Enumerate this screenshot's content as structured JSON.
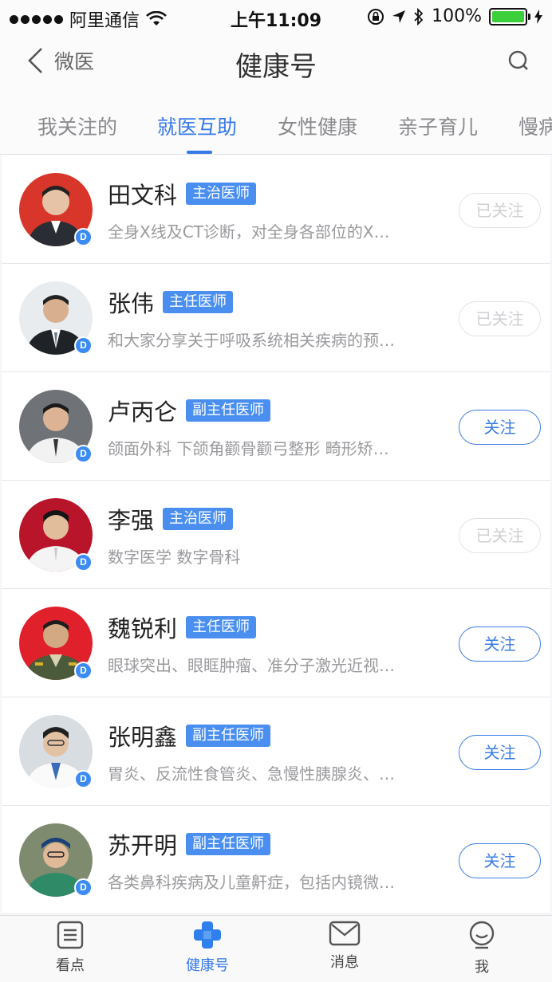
{
  "status_bar": {
    "carrier": "阿里通信",
    "time": "上午11:09",
    "battery": "100%"
  },
  "nav": {
    "back_label": "微医",
    "title": "健康号",
    "search_icon": "search-icon"
  },
  "tabs": [
    {
      "label": "我关注的"
    },
    {
      "label": "就医互助",
      "active": true
    },
    {
      "label": "女性健康"
    },
    {
      "label": "亲子育儿"
    },
    {
      "label": "慢病"
    }
  ],
  "doctors": [
    {
      "name": "田文科",
      "rank": "主治医师",
      "desc": "全身X线及CT诊断，对全身各部位的X…",
      "verified": "D",
      "follow_label": "已关注",
      "following": true,
      "avatar_bg": "#d8362a"
    },
    {
      "name": "张伟",
      "rank": "主任医师",
      "desc": "和大家分享关于呼吸系统相关疾病的预…",
      "verified": "D",
      "follow_label": "已关注",
      "following": true,
      "avatar_bg": "#e9ecef"
    },
    {
      "name": "卢丙仑",
      "rank": "副主任医师",
      "desc": "颌面外科 下颌角颧骨颧弓整形 畸形矫…",
      "verified": "D",
      "follow_label": "关注",
      "following": false,
      "avatar_bg": "#6f7277"
    },
    {
      "name": "李强",
      "rank": "主治医师",
      "desc": "数字医学 数字骨科",
      "verified": "D",
      "follow_label": "已关注",
      "following": true,
      "avatar_bg": "#b8142a"
    },
    {
      "name": "魏锐利",
      "rank": "主任医师",
      "desc": "眼球突出、眼眶肿瘤、准分子激光近视…",
      "verified": "D",
      "follow_label": "关注",
      "following": false,
      "avatar_bg": "#e0202a"
    },
    {
      "name": "张明鑫",
      "rank": "副主任医师",
      "desc": "胃炎、反流性食管炎、急慢性胰腺炎、…",
      "verified": "D",
      "follow_label": "关注",
      "following": false,
      "avatar_bg": "#d8dde2"
    },
    {
      "name": "苏开明",
      "rank": "副主任医师",
      "desc": "各类鼻科疾病及儿童鼾症，包括内镜微…",
      "verified": "D",
      "follow_label": "关注",
      "following": false,
      "avatar_bg": "#7f8b6e"
    }
  ],
  "bottom_tabs": [
    {
      "label": "看点",
      "icon": "news-icon"
    },
    {
      "label": "健康号",
      "icon": "health-cross-icon",
      "active": true
    },
    {
      "label": "消息",
      "icon": "mail-icon"
    },
    {
      "label": "我",
      "icon": "profile-icon"
    }
  ],
  "colors": {
    "accent": "#3478e8",
    "rank_badge": "#4a8ff0"
  }
}
